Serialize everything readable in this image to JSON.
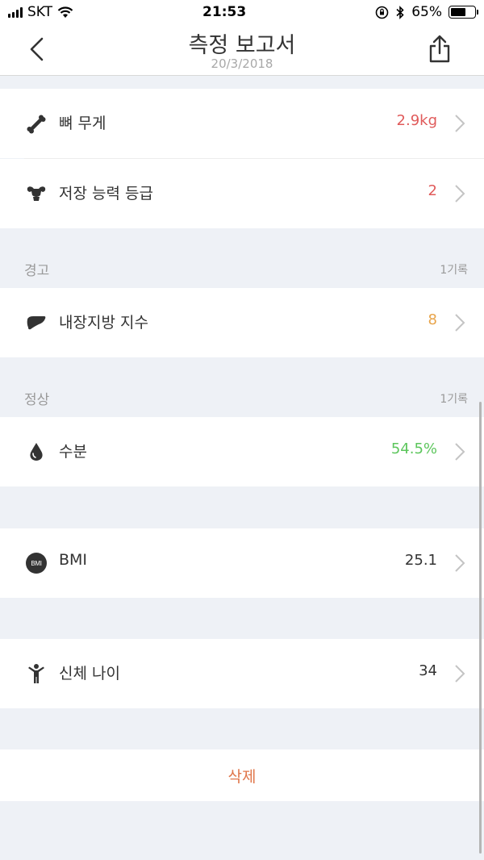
{
  "status_bar": {
    "carrier": "SKT",
    "time": "21:53",
    "battery": "65%"
  },
  "header": {
    "title": "측정 보고서",
    "date": "20/3/2018"
  },
  "rows": {
    "bone_weight": {
      "label": "뼈 무게",
      "value": "2.9kg",
      "icon": "bone-icon"
    },
    "storage_grade": {
      "label": "저장 능력 등급",
      "value": "2",
      "icon": "muscle-torso-icon"
    },
    "visceral_fat": {
      "label": "내장지방 지수",
      "value": "8",
      "icon": "liver-icon"
    },
    "water": {
      "label": "수분",
      "value": "54.5%",
      "icon": "water-drop-icon"
    },
    "bmi": {
      "label": "BMI",
      "value": "25.1",
      "icon": "bmi-badge-icon",
      "icon_text": "BMI"
    },
    "body_age": {
      "label": "신체 나이",
      "value": "34",
      "icon": "person-icon"
    }
  },
  "sections": {
    "warning": {
      "title": "경고",
      "count": "1기록"
    },
    "normal": {
      "title": "정상",
      "count": "1기록"
    }
  },
  "actions": {
    "delete_label": "삭제"
  },
  "colors": {
    "red": "#e05a5a",
    "orange": "#e8a44a",
    "green": "#5cc65c",
    "dark": "#333333",
    "delete": "#e0764a",
    "background": "#eef1f6"
  }
}
